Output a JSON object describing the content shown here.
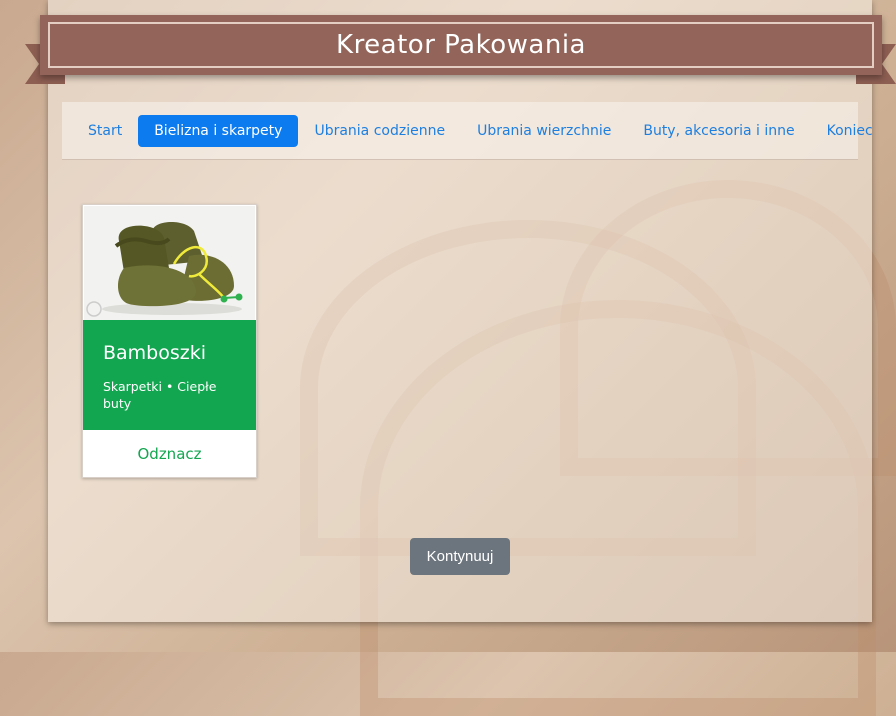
{
  "header": {
    "title": "Kreator Pakowania"
  },
  "nav": {
    "items": [
      {
        "label": "Start"
      },
      {
        "label": "Bielizna i skarpety"
      },
      {
        "label": "Ubrania codzienne"
      },
      {
        "label": "Ubrania wierzchnie"
      },
      {
        "label": "Buty, akcesoria i inne"
      },
      {
        "label": "Koniec"
      }
    ],
    "active_index": 1
  },
  "card": {
    "title": "Bamboszki",
    "tags": "Skarpetki • Ciepłe buty",
    "action_label": "Odznacz",
    "image_icon": "slippers-image",
    "accent_color": "#13a650"
  },
  "footer": {
    "continue_label": "Kontynuuj"
  },
  "colors": {
    "ribbon": "#93655a",
    "active_tab": "#0d7bf0",
    "link": "#1d7fe0",
    "button": "#6c757d"
  }
}
